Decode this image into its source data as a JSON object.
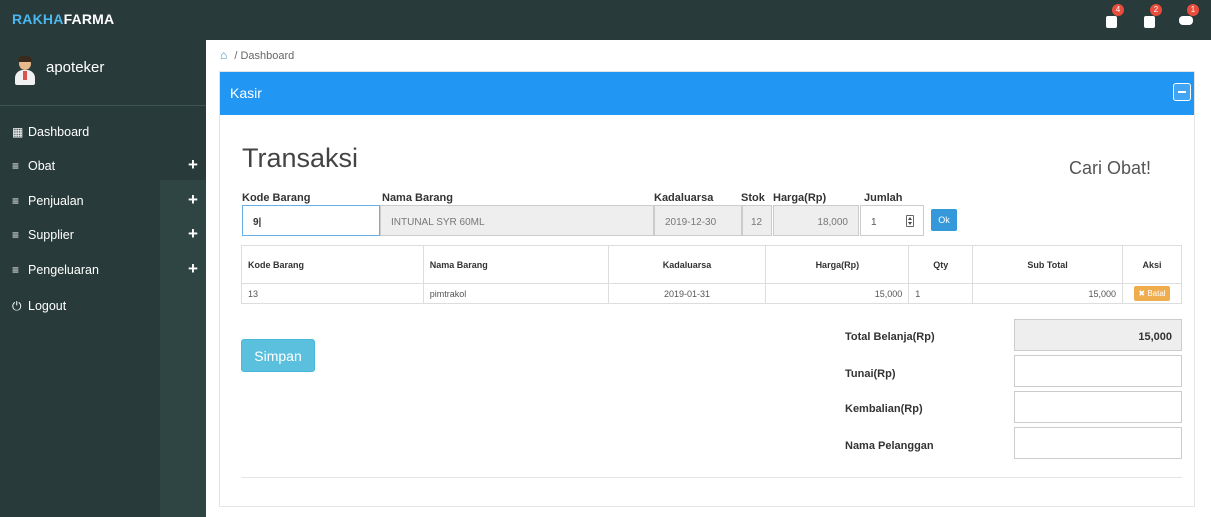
{
  "brand": {
    "part1": "RAKHA",
    "part2": "FARMA"
  },
  "topbar": {
    "icons": [
      {
        "icon": "medicine-icon",
        "badge": "4"
      },
      {
        "icon": "calendar-icon",
        "badge": "2"
      },
      {
        "icon": "binoculars-icon",
        "badge": "1"
      }
    ]
  },
  "user": {
    "name": "apoteker"
  },
  "sidebar": {
    "items": [
      {
        "icon": "▦",
        "label": "Dashboard",
        "expand": ""
      },
      {
        "icon": "≡",
        "label": "Obat",
        "expand": "+"
      },
      {
        "icon": "≡",
        "label": "Penjualan",
        "expand": "+"
      },
      {
        "icon": "≡",
        "label": "Supplier",
        "expand": "+"
      },
      {
        "icon": "≡",
        "label": "Pengeluaran",
        "expand": "+"
      },
      {
        "icon": "⏻",
        "label": "Logout",
        "expand": ""
      }
    ]
  },
  "breadcrumb": {
    "icon": "⌂",
    "sep": "/",
    "current": "Dashboard"
  },
  "panel": {
    "title": "Kasir"
  },
  "page": {
    "title": "Transaksi",
    "search": "Cari Obat!"
  },
  "form": {
    "labels": {
      "kode": "Kode Barang",
      "nama": "Nama Barang",
      "kadaluarsa": "Kadaluarsa",
      "stok": "Stok",
      "harga": "Harga(Rp)",
      "jumlah": "Jumlah"
    },
    "values": {
      "kode": "9|",
      "nama": "INTUNAL SYR 60ML",
      "kadaluarsa": "2019-12-30",
      "stok": "12",
      "harga": "18,000",
      "jumlah": "1"
    },
    "ok": "Ok"
  },
  "table": {
    "headers": [
      "Kode Barang",
      "Nama Barang",
      "Kadaluarsa",
      "Harga(Rp)",
      "Qty",
      "Sub Total",
      "Aksi"
    ],
    "rows": [
      {
        "kode": "13",
        "nama": "pimtrakol",
        "kadaluarsa": "2019-01-31",
        "harga": "15,000",
        "qty": "1",
        "subtotal": "15,000",
        "aksi": "✖ Batal"
      }
    ]
  },
  "summary": {
    "simpan": "Simpan",
    "total_label": "Total Belanja(Rp)",
    "total_value": "15,000",
    "tunai_label": "Tunai(Rp)",
    "tunai_value": "",
    "kembalian_label": "Kembalian(Rp)",
    "kembalian_value": "",
    "pelanggan_label": "Nama Pelanggan",
    "pelanggan_value": ""
  },
  "colors": {
    "topbar": "#283b3a",
    "brand_accent": "#4ab7f0",
    "panel_header": "#2196f3",
    "ok_button": "#3498db",
    "simpan_button": "#5bc0de",
    "batal_button": "#f0ad4e",
    "badge": "#e74c3c"
  }
}
